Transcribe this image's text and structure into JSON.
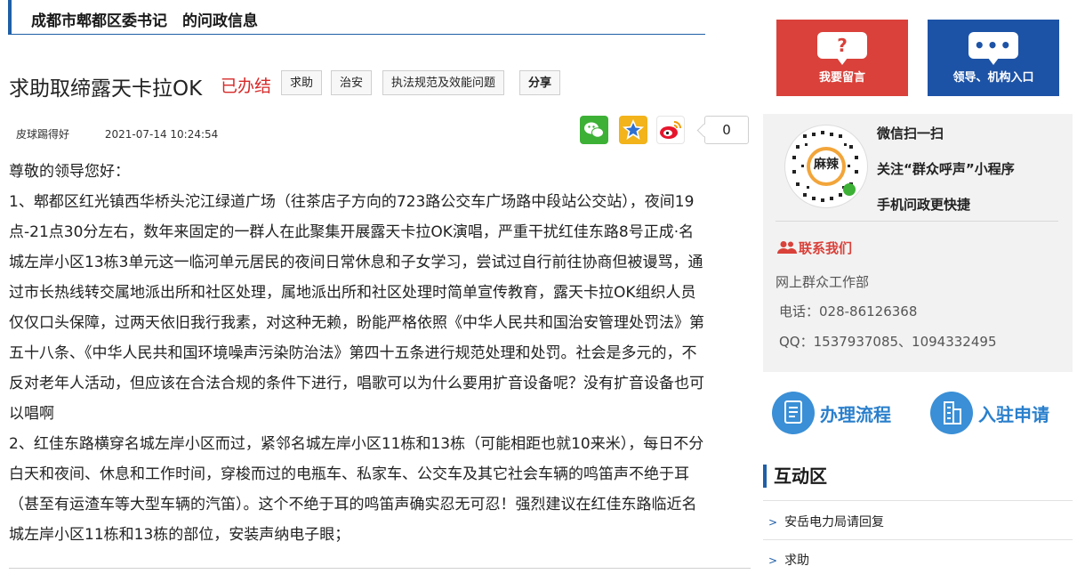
{
  "breadcrumb": {
    "text": "成都市郫都区委书记　的问政信息"
  },
  "post": {
    "title": "求助取缔露天卡拉OK",
    "status": "已办结",
    "tags": [
      "求助",
      "治安",
      "执法规范及效能问题"
    ],
    "share_label": "分享",
    "author": "皮球踢得好",
    "datetime": "2021-07-14 10:24:54",
    "share_count": "0",
    "body": [
      "尊敬的领导您好：",
      "1、郫都区红光镇西华桥头沱江绿道广场（往茶店子方向的723路公交车广场路中段站公交站），夜间19点-21点30分左右，数年来固定的一群人在此聚集开展露天卡拉OK演唱，严重干扰红佳东路8号正成·名城左岸小区13栋3单元这一临河单元居民的夜间日常休息和子女学习，尝试过自行前往协商但被谩骂，通过市长热线转交属地派出所和社区处理，属地派出所和社区处理时简单宣传教育，露天卡拉OK组织人员仅仅口头保障，过两天依旧我行我素，对这种无赖，盼能严格依照《中华人民共和国治安管理处罚法》第五十八条、《中华人民共和国环境噪声污染防治法》第四十五条进行规范处理和处罚。社会是多元的，不反对老年人活动，但应该在合法合规的条件下进行，唱歌可以为什么要用扩音设备呢？没有扩音设备也可以唱啊",
      "2、红佳东路横穿名城左岸小区而过，紧邻名城左岸小区11栋和13栋（可能相距也就10来米），每日不分白天和夜间、休息和工作时间，穿梭而过的电瓶车、私家车、公交车及其它社会车辆的鸣笛声不绝于耳（甚至有运渣车等大型车辆的汽笛）。这个不绝于耳的鸣笛声确实忍无可忍！强烈建议在红佳东路临近名城左岸小区11栋和13栋的部位，安装声纳电子眼；"
    ]
  },
  "sidebar": {
    "leave_message": {
      "glyph": "?",
      "label": "我要留言"
    },
    "leader_entry": {
      "glyph": "•••",
      "label": "领导、机构入口"
    },
    "qr": {
      "badge_text": "麻辣",
      "lines": [
        "微信扫一扫",
        "关注“群众呼声”小程序",
        "手机问政更快捷"
      ]
    },
    "contact": {
      "title": "联系我们",
      "dept": "网上群众工作部",
      "phone": "电话：028-86126368",
      "qq": "QQ：1537937085、1094332495"
    },
    "process": [
      {
        "label": "办理流程"
      },
      {
        "label": "入驻申请"
      }
    ],
    "interactive": {
      "title": "互动区",
      "items": [
        "安岳电力局请回复",
        "求助"
      ]
    }
  },
  "colors": {
    "accent_blue": "#1f5fa6",
    "status_red": "#d62828",
    "btn_red": "#d9413a",
    "btn_blue": "#1d53a6"
  }
}
